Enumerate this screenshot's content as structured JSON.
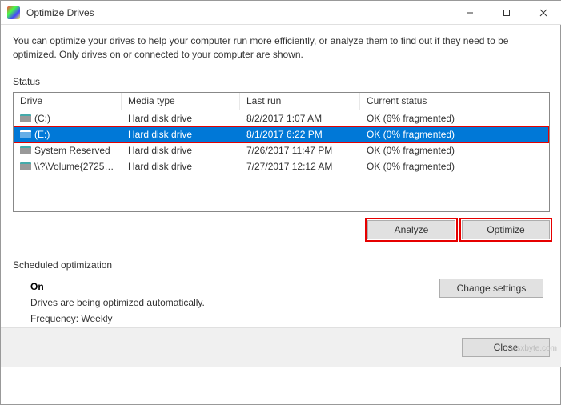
{
  "titlebar": {
    "title": "Optimize Drives"
  },
  "description": "You can optimize your drives to help your computer run more efficiently, or analyze them to find out if they need to be optimized. Only drives on or connected to your computer are shown.",
  "status_label": "Status",
  "columns": {
    "drive": "Drive",
    "media": "Media type",
    "last": "Last run",
    "status": "Current status"
  },
  "drives": [
    {
      "name": "(C:)",
      "media": "Hard disk drive",
      "last": "8/2/2017 1:07 AM",
      "status": "OK (6% fragmented)"
    },
    {
      "name": "(E:)",
      "media": "Hard disk drive",
      "last": "8/1/2017 6:22 PM",
      "status": "OK (0% fragmented)"
    },
    {
      "name": "System Reserved",
      "media": "Hard disk drive",
      "last": "7/26/2017 11:47 PM",
      "status": "OK (0% fragmented)"
    },
    {
      "name": "\\\\?\\Volume{27258...",
      "media": "Hard disk drive",
      "last": "7/27/2017 12:12 AM",
      "status": "OK (0% fragmented)"
    }
  ],
  "buttons": {
    "analyze": "Analyze",
    "optimize": "Optimize",
    "change_settings": "Change settings",
    "close": "Close"
  },
  "schedule": {
    "label": "Scheduled optimization",
    "state": "On",
    "line1": "Drives are being optimized automatically.",
    "line2": "Frequency: Weekly"
  },
  "watermark": "wsxbyte.com"
}
